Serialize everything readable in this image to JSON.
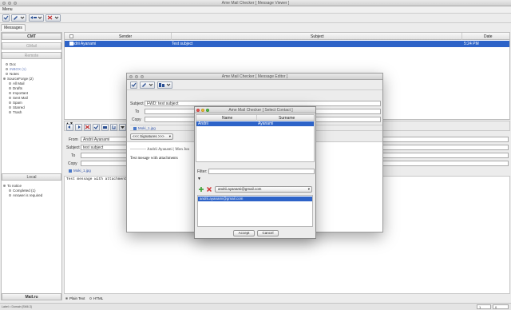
{
  "main_window": {
    "title": "Ame Mail Checker [ Message Viewer ]",
    "menu_label": "Menu",
    "tab_label": "Messages"
  },
  "sidebar": {
    "cmt_header": "CMT",
    "gmail_header": "GMail",
    "remote_header": "Remote",
    "folders": [
      {
        "label": "Doc"
      },
      {
        "label": "INBOX (1)"
      },
      {
        "label": "Notes"
      },
      {
        "label": "SourceForge (2)"
      },
      {
        "label": "All Mail"
      },
      {
        "label": "Drafts"
      },
      {
        "label": "Important"
      },
      {
        "label": "Sent Mail"
      },
      {
        "label": "Spam"
      },
      {
        "label": "Starred"
      },
      {
        "label": "Trash"
      }
    ],
    "local_header": "Local",
    "local_items": [
      {
        "label": "To notice"
      },
      {
        "label": "Completed (1)"
      },
      {
        "label": "Answer is required"
      }
    ],
    "mailru_header": "Mail.ru"
  },
  "message_list": {
    "columns": [
      "Sender",
      "Subject",
      "Date"
    ],
    "rows": [
      {
        "sender": "Andrii Ayanami",
        "subject": "Test subject",
        "date": "5:24 PM"
      }
    ]
  },
  "message_view": {
    "from_label": "From",
    "from_value": "Andrii Ayanami",
    "subject_label": "Subject",
    "subject_value": "test subject",
    "to_label": "To",
    "copy_label": "Copy",
    "attachment": "Moki_1.jpg",
    "body_text": "Test message with attachments",
    "format_plain": "Plain Text",
    "format_html": "HTML"
  },
  "editor_window": {
    "title": "Ame Mail Checker [ Message Editor ]",
    "subject_label": "Subject",
    "subject_value": "FWD: test subject",
    "to_label": "To",
    "copy_label": "Copy",
    "attachment": "Moki_1.jpg",
    "signatures_label": "<<< Signatures >>>",
    "quote_header": "Andrii Ayanami | Mon Jun",
    "body_text": "Test mesage with attachments"
  },
  "contact_dialog": {
    "title": "Ame Mail Checker [ Select Contact ]",
    "columns": [
      "Name",
      "Surname"
    ],
    "rows": [
      {
        "name": "Andrii",
        "surname": "Ayanami"
      }
    ],
    "filter_label": "Filter:",
    "filter_value": "",
    "email_select": "andrii.ayanami@gmail.com",
    "emails": [
      "andrii.ayanami@gmail.com"
    ],
    "accept_label": "Accept",
    "cancel_label": "Cancel"
  },
  "status_bar": {
    "left_text": "Label = Domain [SM6.3]",
    "field_1": "1",
    "field_2": "0"
  }
}
